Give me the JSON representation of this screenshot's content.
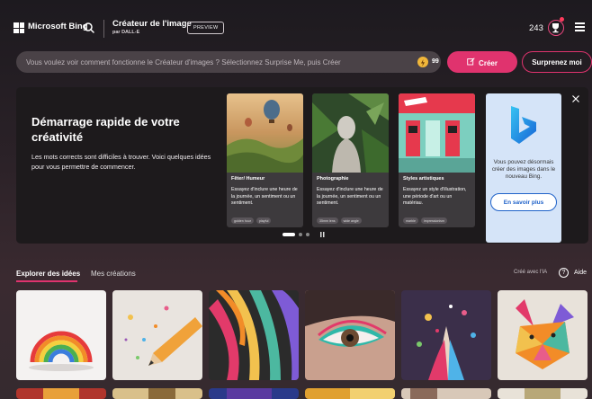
{
  "header": {
    "brand": "Microsoft Bing",
    "app_title": "Créateur de l'image",
    "app_subtitle": "par DALL-E",
    "preview_badge": "PREVIEW",
    "reward_count": "243",
    "icons": [
      "windows-logo-icon",
      "search-icon",
      "rewards-icon",
      "hamburger-menu-icon"
    ]
  },
  "prompt": {
    "placeholder": "Vous voulez voir comment fonctionne le Créateur d'images ? Sélectionnez Surprise Me, puis Créer",
    "boost_count": "99",
    "create_label": "Créer",
    "surprise_label": "Surprenez moi"
  },
  "quick_start": {
    "title": "Démarrage rapide de votre créativité",
    "description": "Les mots corrects sont difficiles à trouver. Voici quelques idées pour vous permettre de commencer.",
    "cards": [
      {
        "title": "Fêter/ Humeur",
        "description": "Essayez d'inclure une heure de la journée, un sentiment ou un sentiment.",
        "chips": [
          "golden hour",
          "playful"
        ]
      },
      {
        "title": "Photographie",
        "description": "Essayez d'inclure une heure de la journée, un sentiment ou un sentiment.",
        "chips": [
          "35mm lens",
          "wide angle"
        ]
      },
      {
        "title": "Styles artistiques",
        "description": "Essayez un style d'illustration, une période d'art ou un matériau.",
        "chips": [
          "marble",
          "impressionism"
        ]
      }
    ],
    "promo": {
      "text": "Vous pouvez désormais créer des images dans le nouveau Bing.",
      "button": "En savoir plus"
    }
  },
  "tabs": {
    "explore": "Explorer des idées",
    "mine": "Mes créations",
    "ai_note": "Créé avec l'IA",
    "help": "Aide"
  },
  "colors": {
    "accent": "#e0336e",
    "background": "#2a2127",
    "promo_background": "#d5e4f8"
  }
}
